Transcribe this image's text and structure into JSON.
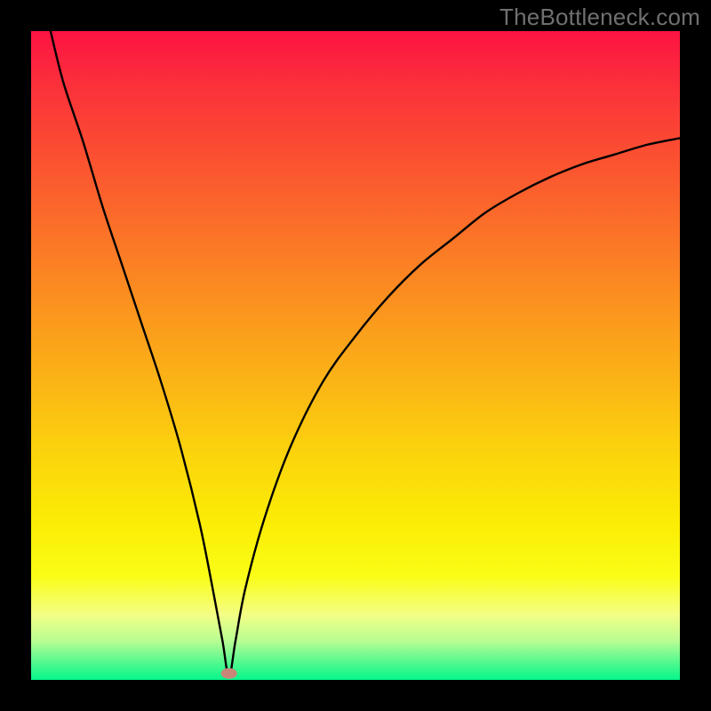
{
  "watermark": "TheBottleneck.com",
  "chart_data": {
    "type": "line",
    "title": "",
    "xlabel": "",
    "ylabel": "",
    "xlim": [
      0,
      100
    ],
    "ylim": [
      0,
      100
    ],
    "grid": false,
    "annotations": {
      "marker": {
        "x": 30.5,
        "y": 1.0,
        "color": "#c98678"
      }
    },
    "series": [
      {
        "name": "curve",
        "color": "#000000",
        "x": [
          3,
          5,
          8,
          11,
          14,
          17,
          20,
          23,
          26,
          28,
          29.5,
          30.5,
          31.5,
          33,
          36,
          40,
          45,
          50,
          55,
          60,
          65,
          70,
          75,
          80,
          85,
          90,
          95,
          100
        ],
        "y": [
          100,
          92,
          83,
          73,
          64,
          55,
          46,
          36,
          24,
          14,
          6,
          0.5,
          6,
          14,
          25,
          36,
          46,
          53,
          59,
          64,
          68,
          72,
          75,
          77.5,
          79.5,
          81,
          82.5,
          83.5
        ]
      }
    ],
    "background_gradient": {
      "direction": "vertical",
      "stops": [
        {
          "pos": 0.0,
          "color": "#fc1342"
        },
        {
          "pos": 0.08,
          "color": "#fb2f3b"
        },
        {
          "pos": 0.18,
          "color": "#fb4c32"
        },
        {
          "pos": 0.3,
          "color": "#fb6f29"
        },
        {
          "pos": 0.42,
          "color": "#fb921f"
        },
        {
          "pos": 0.54,
          "color": "#fbb416"
        },
        {
          "pos": 0.66,
          "color": "#fbd60c"
        },
        {
          "pos": 0.76,
          "color": "#fbed05"
        },
        {
          "pos": 0.84,
          "color": "#fafd17"
        },
        {
          "pos": 0.9,
          "color": "#f3fe86"
        },
        {
          "pos": 0.94,
          "color": "#b8fd93"
        },
        {
          "pos": 0.97,
          "color": "#5cf98f"
        },
        {
          "pos": 1.0,
          "color": "#05f68b"
        }
      ]
    }
  }
}
